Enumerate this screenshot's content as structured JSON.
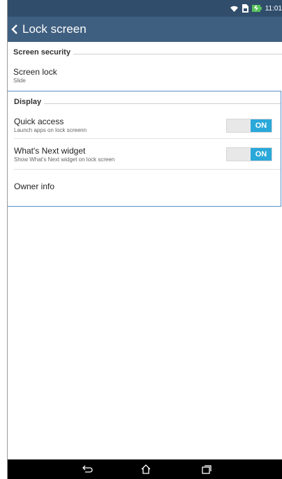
{
  "status_bar": {
    "time": "11:01",
    "icons": [
      "wifi-icon",
      "sim-icon",
      "battery-icon"
    ],
    "battery_color": "#58c25b"
  },
  "action_bar": {
    "title": "Lock screen",
    "back_icon": "chevron-left-icon"
  },
  "sections": [
    {
      "category": "Screen security",
      "items": [
        {
          "title": "Screen lock",
          "summary": "Slide"
        }
      ]
    },
    {
      "category": "Display",
      "items": [
        {
          "title": "Quick access",
          "summary": "Launch apps on lock screenn",
          "toggle": "ON"
        },
        {
          "title": "What's Next widget",
          "summary": "Show What's Next widget on lock screen",
          "toggle": "ON"
        },
        {
          "title": "Owner info"
        }
      ]
    }
  ],
  "nav_bar": {
    "buttons": [
      "back-icon",
      "home-icon",
      "recents-icon"
    ]
  },
  "colors": {
    "status_bar": "#304e6c",
    "action_bar": "#3f5f80",
    "toggle_on": "#2aa8d9",
    "focus_border": "#5a8fc7"
  }
}
